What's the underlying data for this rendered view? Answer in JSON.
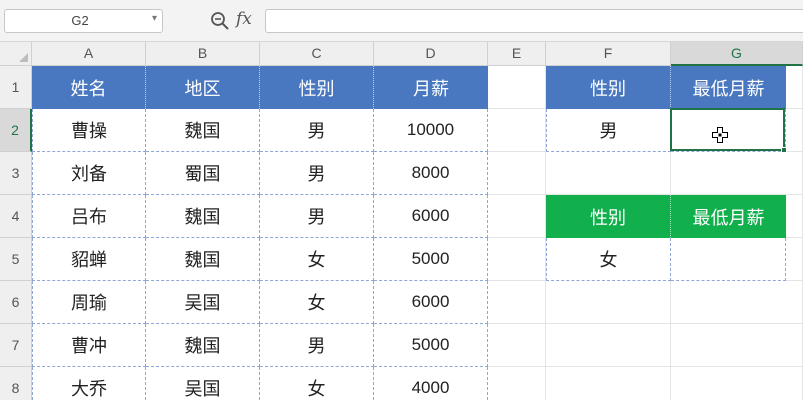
{
  "formula_bar": {
    "name_box": "G2",
    "fx_label": "fx",
    "formula_value": ""
  },
  "columns": [
    {
      "letter": "A"
    },
    {
      "letter": "B"
    },
    {
      "letter": "C"
    },
    {
      "letter": "D"
    },
    {
      "letter": "E"
    },
    {
      "letter": "F"
    },
    {
      "letter": "G"
    }
  ],
  "rows": [
    "1",
    "2",
    "3",
    "4",
    "5",
    "6",
    "7",
    "8"
  ],
  "table": {
    "headers": [
      "姓名",
      "地区",
      "性别",
      "月薪"
    ],
    "rows": [
      [
        "曹操",
        "魏国",
        "男",
        "10000"
      ],
      [
        "刘备",
        "蜀国",
        "男",
        "8000"
      ],
      [
        "吕布",
        "魏国",
        "男",
        "6000"
      ],
      [
        "貂蝉",
        "魏国",
        "女",
        "5000"
      ],
      [
        "周瑜",
        "吴国",
        "女",
        "6000"
      ],
      [
        "曹冲",
        "魏国",
        "男",
        "5000"
      ],
      [
        "大乔",
        "吴国",
        "女",
        "4000"
      ]
    ]
  },
  "lookup1": {
    "headers": [
      "性别",
      "最低月薪"
    ],
    "values": [
      "男",
      ""
    ]
  },
  "lookup2": {
    "headers": [
      "性别",
      "最低月薪"
    ],
    "values": [
      "女",
      ""
    ]
  },
  "colors": {
    "header_blue": "#4a78c0",
    "header_green": "#12b04c",
    "selection_green": "#217346"
  },
  "icons": {
    "zoom": "zoom-formula-icon",
    "cursor": "cell-select-cursor-icon"
  }
}
